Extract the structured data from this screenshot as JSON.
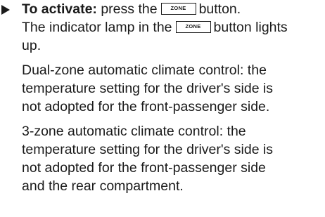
{
  "step": {
    "bold_label": "To activate:",
    "text_before_key": " press the",
    "key_label": "ZONE",
    "text_after_key": "button.",
    "line2_before_key": "The indicator lamp in the",
    "line2_after_key": "button lights",
    "line3": "up."
  },
  "paragraphs": {
    "dual_zone": [
      "Dual-zone automatic climate control: the",
      "temperature setting for the driver's side is",
      "not adopted for the front-passenger side."
    ],
    "three_zone": [
      "3-zone automatic climate control: the",
      "temperature setting for the driver's side is",
      "not adopted for the front-passenger side",
      "and the rear compartment."
    ]
  }
}
